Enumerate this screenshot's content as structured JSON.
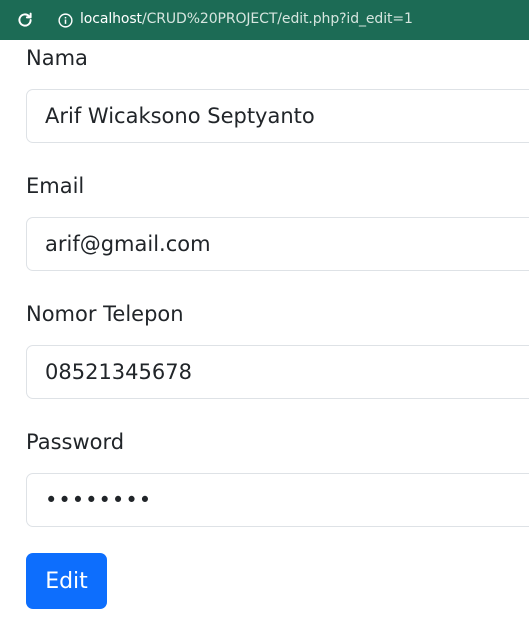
{
  "browser": {
    "url_host": "localhost",
    "url_path": "/CRUD%20PROJECT/edit.php?id_edit=1",
    "reload_icon": "reload-icon",
    "info_icon": "info-icon",
    "bar_color": "#1c6b55"
  },
  "form": {
    "fields": [
      {
        "label": "Nama",
        "value": "Arif Wicaksono Septyanto"
      },
      {
        "label": "Email",
        "value": "arif@gmail.com"
      },
      {
        "label": "Nomor Telepon",
        "value": "08521345678"
      },
      {
        "label": "Password",
        "value": "••••••••"
      }
    ],
    "submit_label": "Edit",
    "button_color": "#0d6efd"
  }
}
